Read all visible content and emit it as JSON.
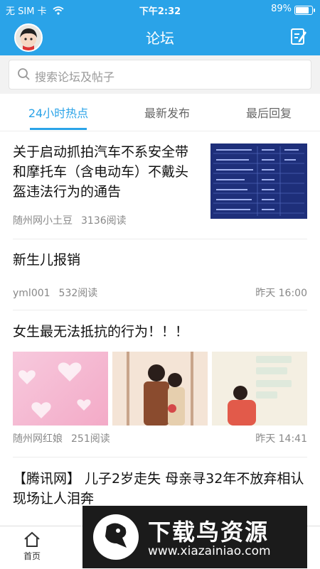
{
  "status": {
    "carrier": "无 SIM 卡",
    "time": "下午2:32",
    "battery": "89%",
    "battery_level": 0.89
  },
  "nav": {
    "title": "论坛",
    "avatar_icon": "user-avatar",
    "compose_icon": "edit-icon"
  },
  "search": {
    "placeholder": "搜索论坛及帖子"
  },
  "tabs": [
    {
      "label": "24小时热点",
      "active": true
    },
    {
      "label": "最新发布",
      "active": false
    },
    {
      "label": "最后回复",
      "active": false
    }
  ],
  "posts": [
    {
      "title": "关于启动抓拍汽车不系安全带和摩托车（含电动车）不戴头盔违法行为的通告",
      "author": "随州网小土豆",
      "reads": "3136阅读",
      "time": ""
    },
    {
      "title": "新生儿报销",
      "author": "yml001",
      "reads": "532阅读",
      "time": "昨天 16:00"
    },
    {
      "title": "女生最无法抵抗的行为！！！",
      "author": "随州网红娘",
      "reads": "251阅读",
      "time": "昨天 14:41"
    },
    {
      "title": "【腾讯网】 儿子2岁走失 母亲寻32年不放弃相认现场让人泪奔",
      "author": "",
      "reads": "",
      "time": ""
    }
  ],
  "bottom_tabs": [
    {
      "label": "首页"
    }
  ],
  "watermark": {
    "brand": "下载鸟资源",
    "url": "www.xiazainiao.com"
  },
  "colors": {
    "accent": "#2aa3e8"
  }
}
